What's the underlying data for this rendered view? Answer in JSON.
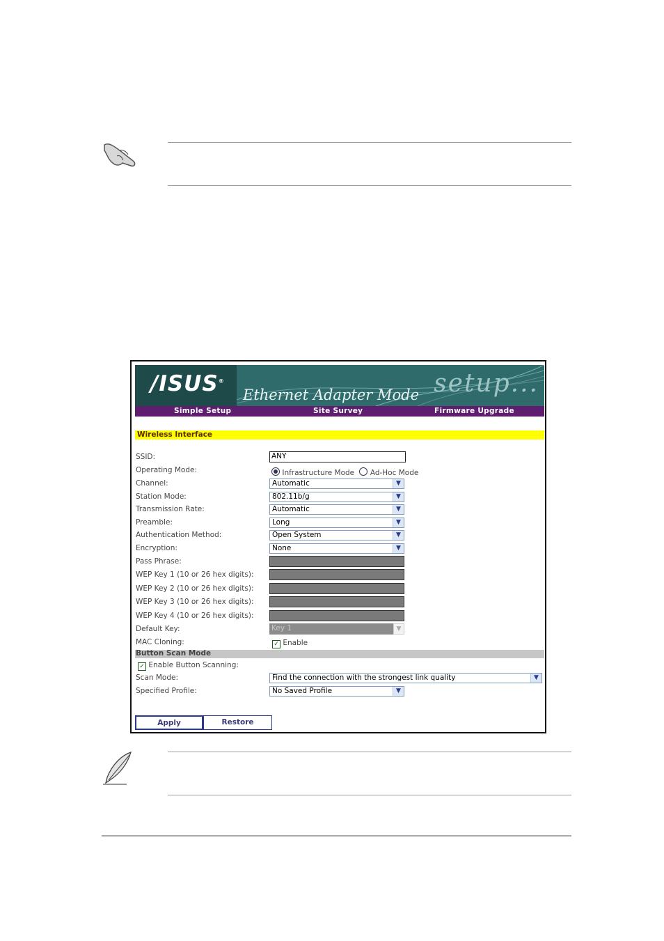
{
  "router_ui": {
    "logo": "/ISUS",
    "banner_title": "Ethernet Adapter Mode",
    "banner_setup": "setup...",
    "nav": [
      "Simple Setup",
      "Site Survey",
      "Firmware Upgrade"
    ],
    "section_title": "Wireless Interface",
    "fields": {
      "ssid_label": "SSID:",
      "ssid_value": "ANY",
      "operating_mode_label": "Operating Mode:",
      "operating_mode_options": [
        "Infrastructure Mode",
        "Ad-Hoc Mode"
      ],
      "channel_label": "Channel:",
      "channel_value": "Automatic",
      "station_mode_label": "Station Mode:",
      "station_mode_value": "802.11b/g",
      "transmission_rate_label": "Transmission Rate:",
      "transmission_rate_value": "Automatic",
      "preamble_label": "Preamble:",
      "preamble_value": "Long",
      "auth_method_label": "Authentication Method:",
      "auth_method_value": "Open System",
      "encryption_label": "Encryption:",
      "encryption_value": "None",
      "pass_phrase_label": "Pass Phrase:",
      "wep_key_1_label": "WEP Key 1 (10 or 26 hex digits):",
      "wep_key_2_label": "WEP Key 2 (10 or 26 hex digits):",
      "wep_key_3_label": "WEP Key 3 (10 or 26 hex digits):",
      "wep_key_4_label": "WEP Key 4 (10 or 26 hex digits):",
      "default_key_label": "Default Key:",
      "default_key_value": "Key 1",
      "mac_cloning_label": "MAC Cloning:",
      "mac_cloning_option": "Enable"
    },
    "scan_section_title": "Button Scan Mode",
    "scan": {
      "enable_label": "Enable Button Scanning:",
      "scan_mode_label": "Scan Mode:",
      "scan_mode_value": "Find the connection with the strongest link quality",
      "profile_label": "Specified Profile:",
      "profile_value": "No Saved Profile"
    },
    "buttons": {
      "apply": "Apply",
      "restore": "Restore"
    }
  },
  "icons": {
    "top_note": "pointing-hand-icon",
    "bottom_note": "feather-pen-icon"
  }
}
